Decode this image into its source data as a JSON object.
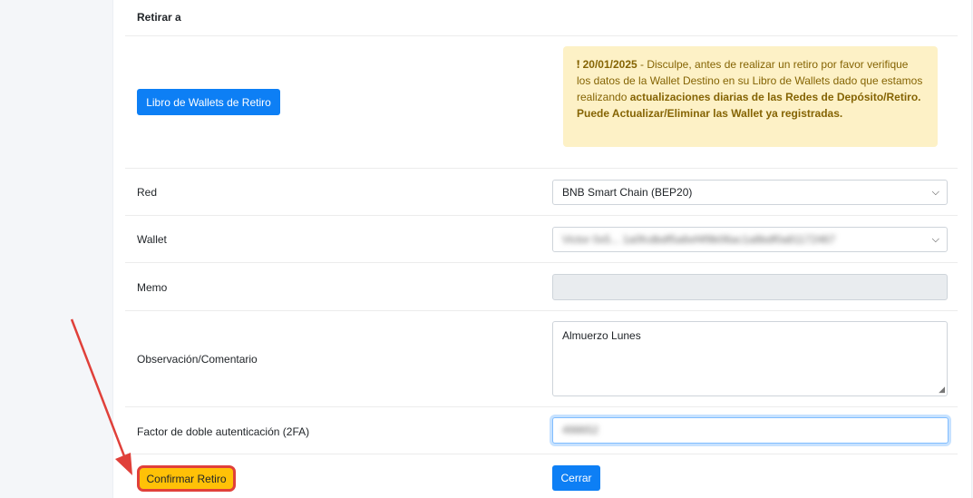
{
  "section_title": "Retirar a",
  "wallet_book_button": "Libro de Wallets de Retiro",
  "alert": {
    "date": "20/01/2025",
    "text_part1": " - Disculpe, antes de realizar un retiro por favor verifique los datos de la Wallet Destino en su Libro de Wallets dado que estamos realizando ",
    "text_bold": "actualizaciones diarias de las Redes de Depósito/Retiro. Puede Actualizar/Eliminar las Wallet ya registradas."
  },
  "form": {
    "red_label": "Red",
    "red_value": "BNB Smart Chain (BEP20)",
    "wallet_label": "Wallet",
    "wallet_value": "Victor 0x5... 1a0fcdbdf5a6ef4f9b06ac1a8bdf0a81172467",
    "memo_label": "Memo",
    "memo_value": "",
    "obs_label": "Observación/Comentario",
    "obs_value": "Almuerzo Lunes",
    "twofa_label": "Factor de doble autenticación (2FA)",
    "twofa_value": "498652"
  },
  "actions": {
    "confirm": "Confirmar Retiro",
    "close": "Cerrar"
  },
  "colors": {
    "primary": "#0d7ff5",
    "warning": "#ffc107",
    "alert_bg": "#fdf1c6",
    "annotation": "#e0403a"
  }
}
